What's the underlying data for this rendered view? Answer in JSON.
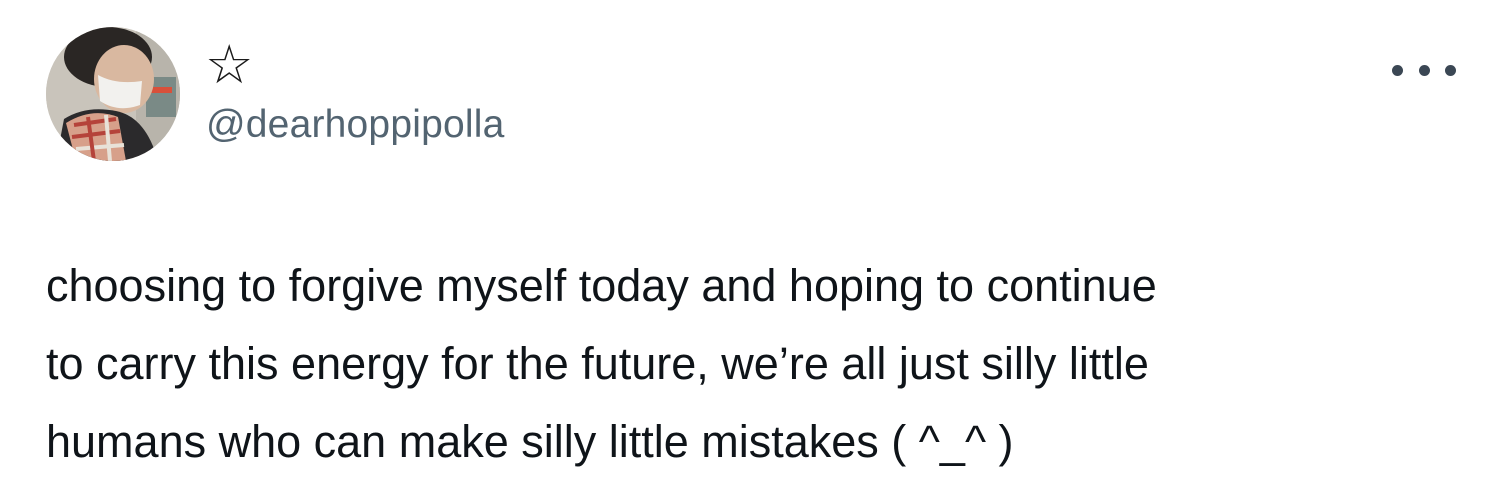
{
  "author": {
    "display_name": "☆",
    "handle": "@dearhoppipolla"
  },
  "tweet": {
    "text": "choosing to forgive myself today and hoping to continue\nto carry this energy for the future, we’re all just silly little\nhumans who can make silly little mistakes ( ^_^ )"
  },
  "icons": {
    "more": "more-horizontal-icon",
    "avatar": "profile-photo"
  }
}
